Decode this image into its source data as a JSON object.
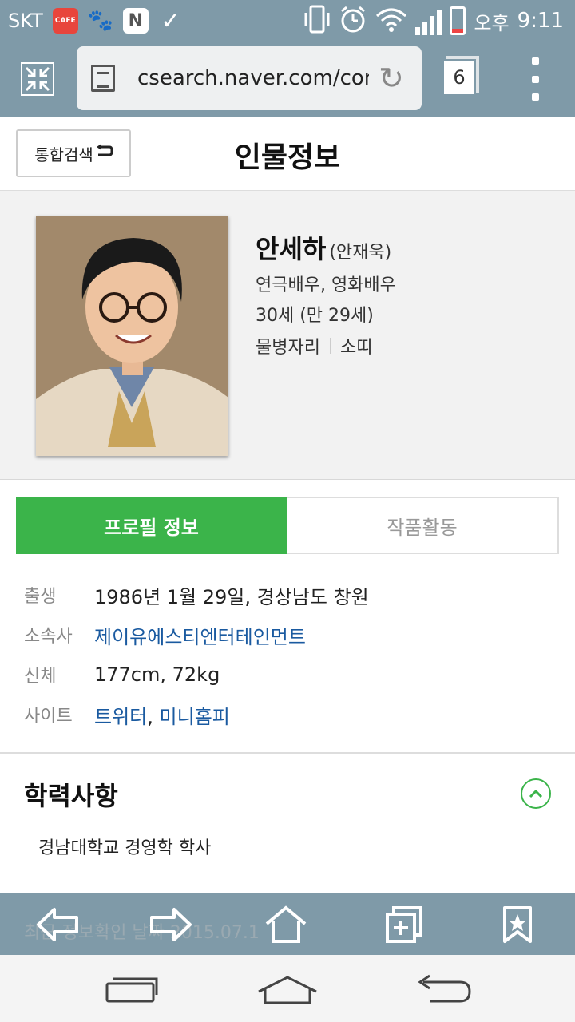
{
  "status_bar": {
    "carrier": "SKT",
    "notification_icons": [
      "cafe-icon",
      "paw-icon",
      "n-icon",
      "download-check-icon"
    ],
    "ampm": "오후",
    "time": "9:11"
  },
  "browser": {
    "url": "csearch.naver.com/conte",
    "tab_count": "6"
  },
  "header": {
    "back_label": "통합검색",
    "title": "인물정보"
  },
  "profile": {
    "name": "안세하",
    "real_name": "(안재욱)",
    "occupation": "연극배우, 영화배우",
    "age": "30세 (만 29세)",
    "zodiac": "물병자리",
    "chinese_zodiac": "소띠"
  },
  "tabs": {
    "profile": "프로필 정보",
    "works": "작품활동"
  },
  "info": {
    "birth_label": "출생",
    "birth_value": "1986년 1월 29일, 경상남도 창원",
    "agency_label": "소속사",
    "agency_value": "제이유에스티엔터테인먼트",
    "body_label": "신체",
    "body_value": "177cm, 72kg",
    "site_label": "사이트",
    "site_twitter": "트위터",
    "site_comma": ",",
    "site_minihompy": "미니홈피"
  },
  "education": {
    "title": "학력사항",
    "item": "경남대학교 경영학 학사"
  },
  "footer": {
    "last_checked": "최근 정보확인 날짜 2015.07.1"
  },
  "colors": {
    "accent_green": "#3bb44a",
    "link_blue": "#1a5aa0",
    "chrome_bluegray": "#7f9aa8"
  }
}
